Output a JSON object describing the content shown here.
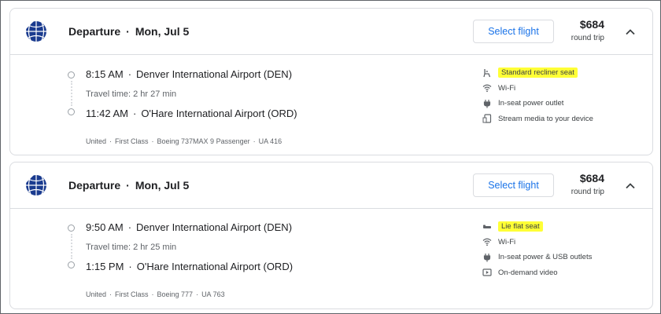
{
  "flights": [
    {
      "header": {
        "label": "Departure",
        "date": "Mon, Jul 5"
      },
      "select_label": "Select flight",
      "price": "$684",
      "price_note": "round trip",
      "departure": {
        "time": "8:15 AM",
        "airport": "Denver International Airport (DEN)"
      },
      "travel_time": "Travel time: 2 hr 27 min",
      "arrival": {
        "time": "11:42 AM",
        "airport": "O'Hare International Airport (ORD)"
      },
      "meta": [
        "United",
        "First Class",
        "Boeing 737MAX 9 Passenger",
        "UA 416"
      ],
      "amenities": [
        {
          "icon": "seat-icon",
          "label": "Standard recliner seat",
          "highlight": true
        },
        {
          "icon": "wifi-icon",
          "label": "Wi-Fi"
        },
        {
          "icon": "power-plug-icon",
          "label": "In-seat power outlet"
        },
        {
          "icon": "stream-media-icon",
          "label": "Stream media to your device"
        }
      ]
    },
    {
      "header": {
        "label": "Departure",
        "date": "Mon, Jul 5"
      },
      "select_label": "Select flight",
      "price": "$684",
      "price_note": "round trip",
      "departure": {
        "time": "9:50 AM",
        "airport": "Denver International Airport (DEN)"
      },
      "travel_time": "Travel time: 2 hr 25 min",
      "arrival": {
        "time": "1:15 PM",
        "airport": "O'Hare International Airport (ORD)"
      },
      "meta": [
        "United",
        "First Class",
        "Boeing 777",
        "UA 763"
      ],
      "amenities": [
        {
          "icon": "lie-flat-seat-icon",
          "label": "Lie flat seat",
          "highlight": true
        },
        {
          "icon": "wifi-icon",
          "label": "Wi-Fi"
        },
        {
          "icon": "power-plug-icon",
          "label": "In-seat power & USB outlets"
        },
        {
          "icon": "on-demand-video-icon",
          "label": "On-demand video"
        }
      ]
    }
  ],
  "separator": "·",
  "colors": {
    "accent": "#1a73e8",
    "highlight": "#ffff36",
    "airline_logo": "#1a3b8f"
  }
}
